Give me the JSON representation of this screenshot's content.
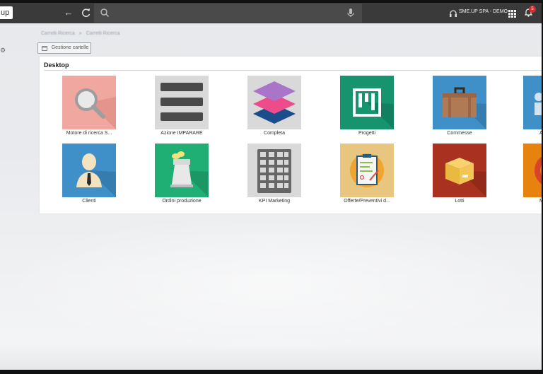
{
  "app": {
    "logo_text": "up",
    "nav_back_glyph": "←",
    "nav_refresh_glyph": "C",
    "search": {
      "value": "",
      "placeholder": ""
    },
    "user_label": "SME.UP SPA - DEMO",
    "notifications_count": "5",
    "colors": {
      "topbar": "#3a3a3a",
      "badge": "#d32f2f"
    }
  },
  "breadcrumb": [
    "Carrelli Ricerca",
    "»",
    "Carrelli Ricerca"
  ],
  "folder_button_label": "Gestione cartelle",
  "desktop": {
    "title": "Desktop",
    "tiles": [
      {
        "label": "Motore di ricerca S...",
        "icon": "magnifier-icon",
        "color": "#f0a7a0"
      },
      {
        "label": "Azione IMPARARE",
        "icon": "list-icon",
        "color": "#d9d9d9"
      },
      {
        "label": "Completa",
        "icon": "layers-icon",
        "color": "#d9d9d9"
      },
      {
        "label": "Progetti",
        "icon": "kanban-icon",
        "color": "#17946e"
      },
      {
        "label": "Commesse",
        "icon": "briefcase-icon",
        "color": "#3f8fc9"
      },
      {
        "label": "A",
        "icon": "partial-icon",
        "color": "#3f8fc9"
      },
      {
        "label": "Clienti",
        "icon": "person-icon",
        "color": "#3f8fc9"
      },
      {
        "label": "Ordini produzione",
        "icon": "factory-icon",
        "color": "#1fae74"
      },
      {
        "label": "KPI Marketing",
        "icon": "calculator-icon",
        "color": "#d9d9d9"
      },
      {
        "label": "Offerte/Preventivi d...",
        "icon": "clipboard-icon",
        "color": "#e8c680"
      },
      {
        "label": "Lotti",
        "icon": "box-icon",
        "color": "#a8321f"
      },
      {
        "label": "M",
        "icon": "target-icon",
        "color": "#e8820e"
      }
    ]
  }
}
